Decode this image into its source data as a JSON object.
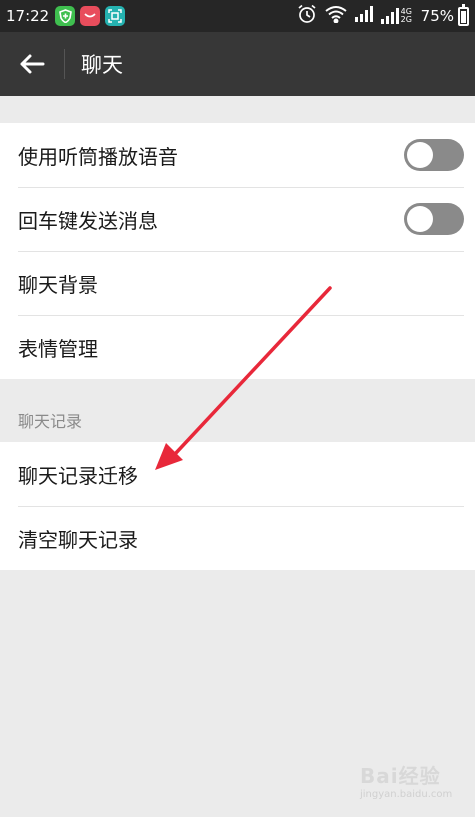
{
  "status_bar": {
    "time": "17:22",
    "network_label": "4G 2G",
    "battery": "75%",
    "battery_level": 0.75,
    "icons": [
      "security-shield-icon",
      "shopping-bag-icon",
      "scan-icon",
      "alarm-icon",
      "wifi-icon",
      "signal-icon",
      "signal-icon",
      "battery-icon"
    ]
  },
  "app_bar": {
    "title": "聊天",
    "back_icon": "arrow-left-icon"
  },
  "settings": {
    "items": [
      {
        "label": "使用听筒播放语音",
        "toggle": false
      },
      {
        "label": "回车键发送消息",
        "toggle": false
      },
      {
        "label": "聊天背景"
      },
      {
        "label": "表情管理"
      }
    ]
  },
  "chat_history": {
    "header": "聊天记录",
    "items": [
      {
        "label": "聊天记录迁移"
      },
      {
        "label": "清空聊天记录"
      }
    ]
  },
  "watermark": {
    "text": "Bai经验",
    "sub": "jingyan.baidu.com"
  },
  "colors": {
    "status_bar_bg": "#262626",
    "app_bar_bg": "#373737",
    "page_bg": "#ebebeb",
    "toggle_off": "#8a8a8a",
    "annotation_arrow": "#e8283a"
  }
}
